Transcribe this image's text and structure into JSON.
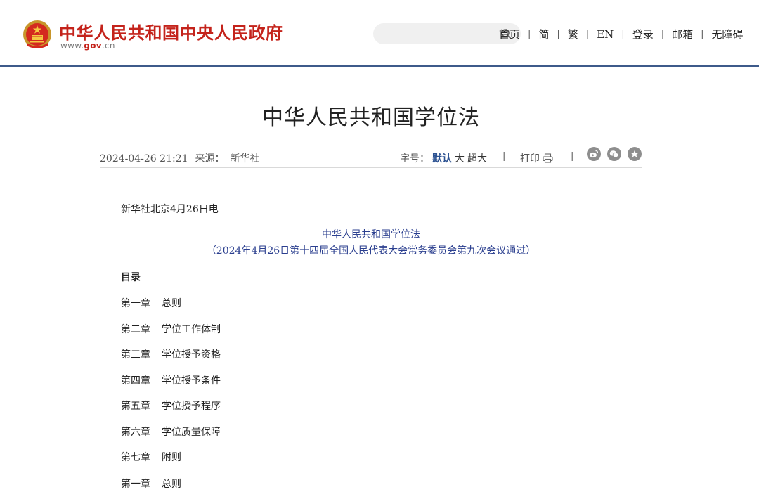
{
  "header": {
    "site_title": "中华人民共和国中央人民政府",
    "site_url_prefix": "www.",
    "site_url_domain": "gov",
    "site_url_suffix": ".cn",
    "search": {
      "placeholder": ""
    },
    "nav": [
      {
        "label": "首页"
      },
      {
        "label": "简"
      },
      {
        "label": "繁"
      },
      {
        "label": "EN"
      },
      {
        "label": "登录"
      },
      {
        "label": "邮箱"
      },
      {
        "label": "无障碍"
      }
    ]
  },
  "article": {
    "title": "中华人民共和国学位法",
    "datetime": "2024-04-26 21:21",
    "source_label": "来源：",
    "source_value": "新华社",
    "font_size_label": "字号：",
    "font_size_options": [
      {
        "label": "默认",
        "active": true
      },
      {
        "label": "大"
      },
      {
        "label": "超大"
      }
    ],
    "print_label": "打印",
    "share": [
      {
        "icon": "weibo-icon"
      },
      {
        "icon": "wechat-icon"
      },
      {
        "icon": "favorite-icon"
      }
    ],
    "dateline": "新华社北京4月26日电",
    "law_title": "中华人民共和国学位法",
    "law_subtitle": "（2024年4月26日第十四届全国人民代表大会常务委员会第九次会议通过）",
    "toc_label": "目录",
    "chapters": [
      {
        "num": "第一章",
        "name": "总则"
      },
      {
        "num": "第二章",
        "name": "学位工作体制"
      },
      {
        "num": "第三章",
        "name": "学位授予资格"
      },
      {
        "num": "第四章",
        "name": "学位授予条件"
      },
      {
        "num": "第五章",
        "name": "学位授予程序"
      },
      {
        "num": "第六章",
        "name": "学位质量保障"
      },
      {
        "num": "第七章",
        "name": "附则"
      }
    ],
    "first_section": {
      "num": "第一章",
      "name": "总则"
    }
  },
  "colors": {
    "brand_red": "#c4231b",
    "accent_blue": "#2b3f8f",
    "header_rule": "#3d5a8a"
  }
}
